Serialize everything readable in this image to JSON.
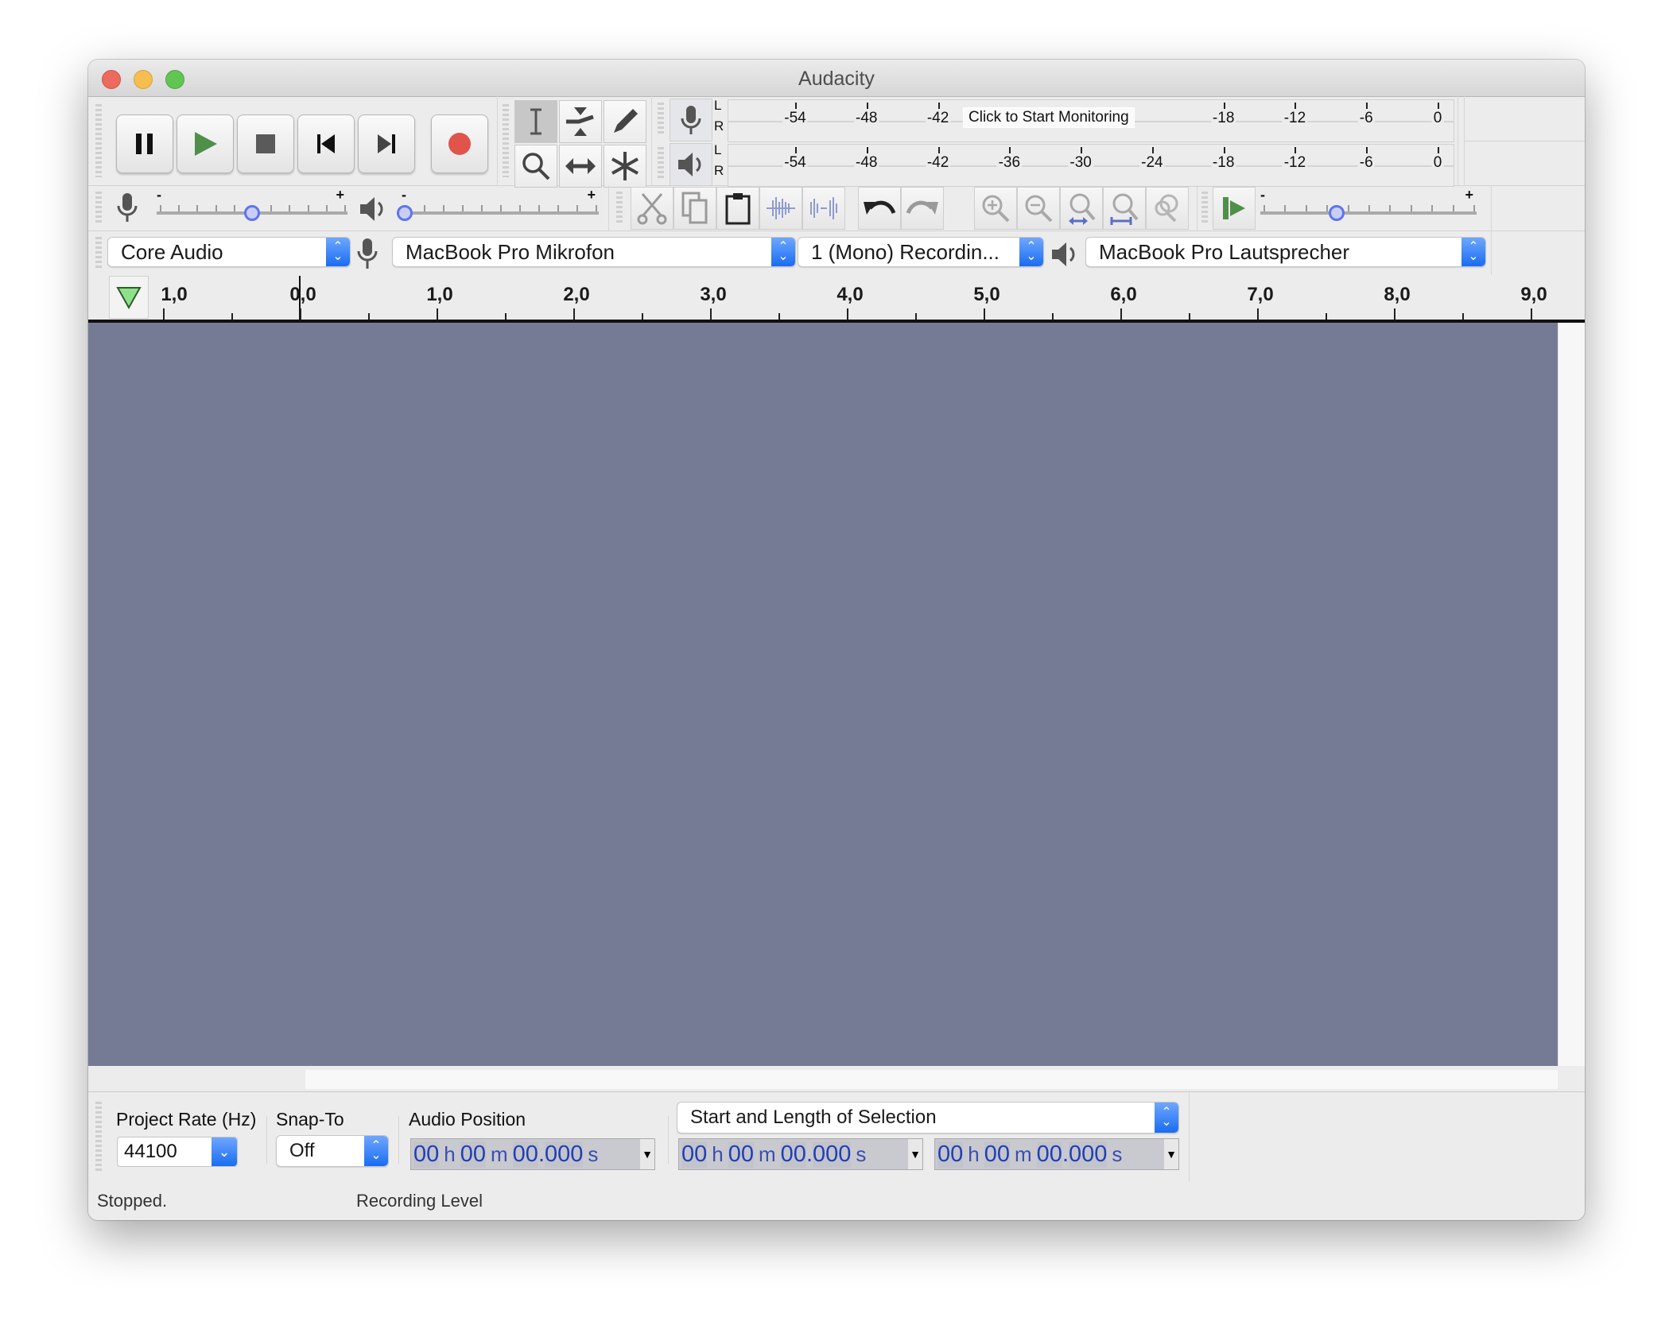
{
  "window": {
    "title": "Audacity"
  },
  "transport": {
    "buttons": [
      {
        "name": "pause",
        "icon": "pause-icon"
      },
      {
        "name": "play",
        "icon": "play-icon"
      },
      {
        "name": "stop",
        "icon": "stop-icon"
      },
      {
        "name": "skip-to-start",
        "icon": "skip-start-icon"
      },
      {
        "name": "skip-to-end",
        "icon": "skip-end-icon"
      },
      {
        "name": "record",
        "icon": "record-icon"
      }
    ],
    "colors": {
      "play": "#4f8f4a",
      "record": "#e0544c"
    }
  },
  "tools": {
    "items": [
      "selection-tool",
      "envelope-tool",
      "draw-tool",
      "zoom-tool",
      "time-shift-tool",
      "multi-tool"
    ],
    "active": "selection-tool"
  },
  "meters": {
    "record": {
      "channels": [
        "L",
        "R"
      ],
      "labels": [
        "-54",
        "-48",
        "-42",
        "-18",
        "-12",
        "-6",
        "0"
      ],
      "monitor_text": "Click to Start Monitoring"
    },
    "playback": {
      "channels": [
        "L",
        "R"
      ],
      "labels": [
        "-54",
        "-48",
        "-42",
        "-36",
        "-30",
        "-24",
        "-18",
        "-12",
        "-6",
        "0"
      ]
    }
  },
  "mixer": {
    "recording_volume": 0.5,
    "playback_volume": 0.0,
    "minus": "-",
    "plus": "+"
  },
  "edit": {
    "items": [
      "cut",
      "copy",
      "paste",
      "trim-audio",
      "silence-audio",
      "undo",
      "redo",
      "zoom-in",
      "zoom-out",
      "fit-selection",
      "fit-project",
      "zoom-toggle"
    ]
  },
  "play_at_speed": {
    "speed": 0.35,
    "minus": "-",
    "plus": "+"
  },
  "devices": {
    "host": "Core Audio",
    "recording_device": "MacBook Pro Mikrofon",
    "channels": "1 (Mono) Recordin...",
    "playback_device": "MacBook Pro Lautsprecher"
  },
  "ruler": {
    "labels": [
      "1,0",
      "0,0",
      "1,0",
      "2,0",
      "3,0",
      "4,0",
      "5,0",
      "6,0",
      "7,0",
      "8,0",
      "9,0"
    ]
  },
  "track": {
    "background": "#767b95"
  },
  "selection_toolbar": {
    "project_rate_label": "Project Rate (Hz)",
    "project_rate_value": "44100",
    "snap_to_label": "Snap-To",
    "snap_to_value": "Off",
    "audio_position_label": "Audio Position",
    "selection_mode": "Start and Length of Selection",
    "audio_position": {
      "h": "00",
      "m": "00",
      "s": "00",
      "ms": "000"
    },
    "selection_start": {
      "h": "00",
      "m": "00",
      "s": "00",
      "ms": "000"
    },
    "selection_length": {
      "h": "00",
      "m": "00",
      "s": "00",
      "ms": "000"
    },
    "units": {
      "h": "h",
      "m": "m",
      "s": "s",
      "dot": "."
    }
  },
  "status": {
    "state": "Stopped.",
    "hint": "Recording Level"
  }
}
